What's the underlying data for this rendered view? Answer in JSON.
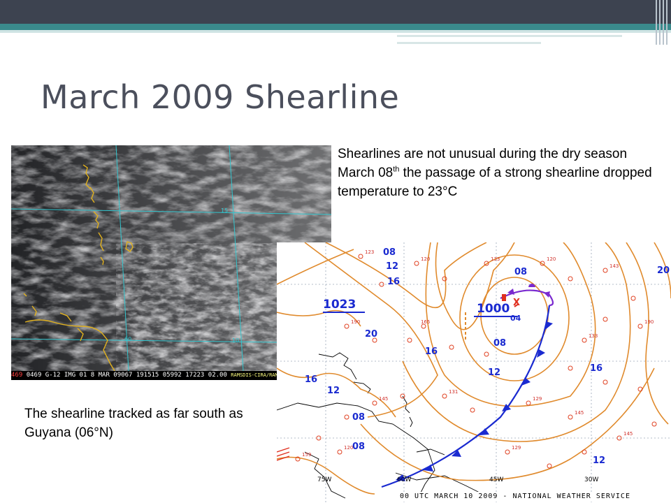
{
  "slide": {
    "title": "March 2009 Shearline",
    "body_lines": [
      "Shearlines are not unusual during the dry season",
      "March 08",
      "th",
      " the passage of a strong shearline dropped temperature to 23°C"
    ],
    "caption": "The shearline tracked as far south as Guyana (06°N)"
  },
  "satellite_image": {
    "grid_labels": [
      "15",
      "60",
      "10"
    ],
    "footer_id": "469",
    "footer_text": "0469 G-12 IMG  01  8 MAR 09067 191515 05992 17223 02.00",
    "footer_credit": "RAMSDIS-CIRA/RAMM"
  },
  "surface_map": {
    "high_label": "1023",
    "low_label": "1000",
    "low_small": "04",
    "low_x": "X",
    "isobar_labels": [
      "08",
      "12",
      "16",
      "20",
      "08",
      "08",
      "16",
      "12",
      "16",
      "12",
      "16",
      "08",
      "20",
      "08",
      "12"
    ],
    "longitude_labels": [
      "75W",
      "60W",
      "45W",
      "30W"
    ],
    "footer": "00 UTC MARCH 10 2009 - NATIONAL WEATHER SERVICE",
    "colors": {
      "isobar": "#e08a2c",
      "front": "#1a2ad0",
      "station": "#e04020",
      "grid": "#7a8aa0",
      "land": "#000000"
    }
  },
  "theme": {
    "header_bar": "#3d4350",
    "accent": "#3a8a8c",
    "title_color": "#4b4f5c"
  }
}
